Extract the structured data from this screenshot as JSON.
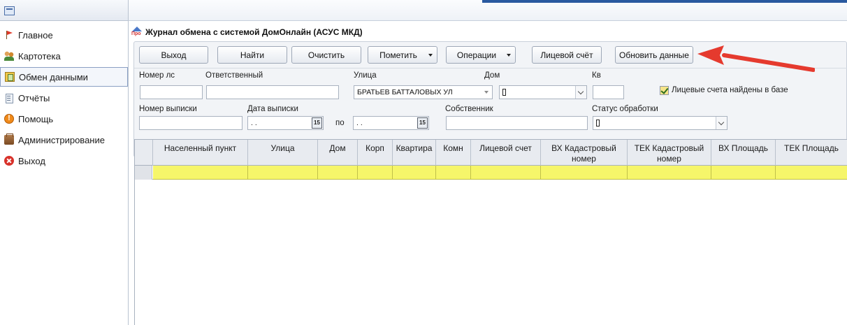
{
  "sidebar": {
    "items": [
      {
        "label": "Главное",
        "icon": "flag-icon"
      },
      {
        "label": "Картотека",
        "icon": "people-icon"
      },
      {
        "label": "Обмен данными",
        "icon": "exchange-icon",
        "active": true
      },
      {
        "label": "Отчёты",
        "icon": "reports-icon"
      },
      {
        "label": "Помощь",
        "icon": "help-icon"
      },
      {
        "label": "Администрирование",
        "icon": "admin-icon"
      },
      {
        "label": "Выход",
        "icon": "exit-icon"
      }
    ]
  },
  "window": {
    "title": "Журнал обмена с системой ДомОнлайн (АСУС МКД)"
  },
  "toolbar": {
    "exit": "Выход",
    "find": "Найти",
    "clear": "Очистить",
    "mark": "Пометить",
    "operations": "Операции",
    "account": "Лицевой счёт",
    "refresh": "Обновить данные"
  },
  "filters": {
    "account_no_label": "Номер лс",
    "responsible_label": "Ответственный",
    "street_label": "Улица",
    "street_value": "БРАТЬЕВ БАТТАЛОВЫХ УЛ",
    "house_label": "Дом",
    "apt_label": "Кв",
    "found_label": "Лицевые счета найдены в базе",
    "statement_no_label": "Номер выписки",
    "statement_date_label": "Дата  выписки",
    "date_from_value": " .  .",
    "to_label": "по",
    "date_to_value": " .  .",
    "owner_label": "Собственник",
    "status_label": "Статус обработки",
    "calendar_glyph": "15"
  },
  "grid": {
    "columns": [
      "Населенный пункт",
      "Улица",
      "Дом",
      "Корп",
      "Квартира",
      "Комн",
      "Лицевой счет",
      "ВХ Кадастровый номер",
      "ТЕК Кадастровый номер",
      "ВХ Площадь",
      "ТЕК Площадь"
    ]
  },
  "colors": {
    "selection_row": "#f6f66a",
    "annotation_arrow": "#e53a2e"
  }
}
